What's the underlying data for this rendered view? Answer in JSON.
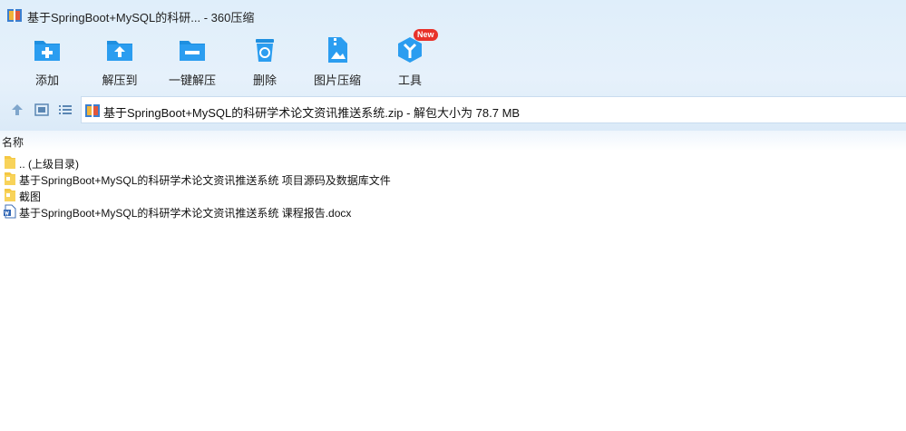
{
  "window": {
    "title": "基于SpringBoot+MySQL的科研... - 360压缩"
  },
  "toolbar": {
    "items": [
      {
        "label": "添加",
        "icon": "add-icon"
      },
      {
        "label": "解压到",
        "icon": "extract-to-icon"
      },
      {
        "label": "一键解压",
        "icon": "one-click-extract-icon"
      },
      {
        "label": "删除",
        "icon": "delete-icon"
      },
      {
        "label": "图片压缩",
        "icon": "image-compress-icon"
      },
      {
        "label": "工具",
        "icon": "tools-icon",
        "badge": "New"
      }
    ]
  },
  "address": {
    "text": "基于SpringBoot+MySQL的科研学术论文资讯推送系统.zip - 解包大小为 78.7 MB"
  },
  "list": {
    "column_name": "名称",
    "rows": [
      {
        "name": ".. (上级目录)",
        "type": "folder"
      },
      {
        "name": "基于SpringBoot+MySQL的科研学术论文资讯推送系统 项目源码及数据库文件",
        "type": "folder"
      },
      {
        "name": "截图",
        "type": "folder"
      },
      {
        "name": "基于SpringBoot+MySQL的科研学术论文资讯推送系统 课程报告.docx",
        "type": "docx"
      }
    ]
  },
  "colors": {
    "accent": "#1e8fe0",
    "folder": "#f5c843",
    "badge": "#e8322a"
  }
}
